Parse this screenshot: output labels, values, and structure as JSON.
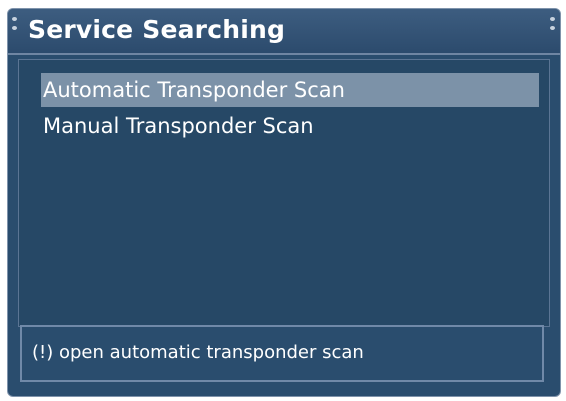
{
  "window": {
    "title": "Service Searching"
  },
  "menu": {
    "items": [
      {
        "label": "Automatic Transponder Scan",
        "selected": true
      },
      {
        "label": "Manual Transponder Scan",
        "selected": false
      }
    ]
  },
  "status": {
    "text": "(!) open automatic transponder scan"
  },
  "colors": {
    "background": "#2a4d6e",
    "selection": "#7c92a8",
    "text": "#ffffff"
  }
}
